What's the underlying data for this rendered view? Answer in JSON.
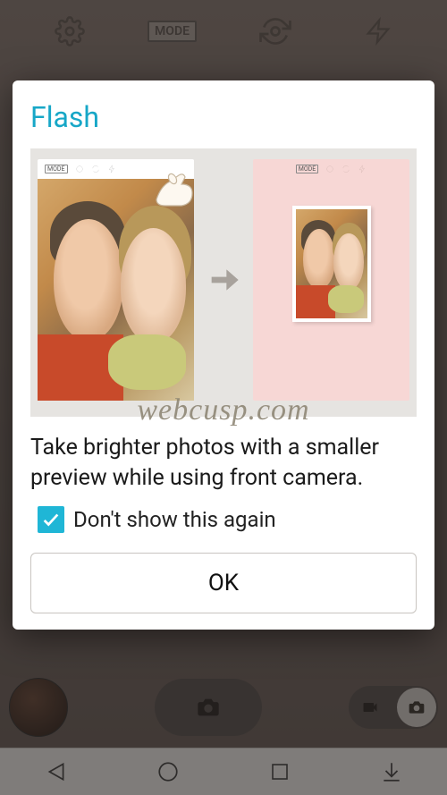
{
  "toolbar": {
    "mode_label": "MODE"
  },
  "dialog": {
    "title": "Flash",
    "description": "Take brighter photos with a smaller preview while using front camera.",
    "checkbox_label": "Don't show this again",
    "checkbox_checked": true,
    "ok_label": "OK",
    "illustration_mode": "MODE"
  },
  "watermark": "webcusp.com"
}
